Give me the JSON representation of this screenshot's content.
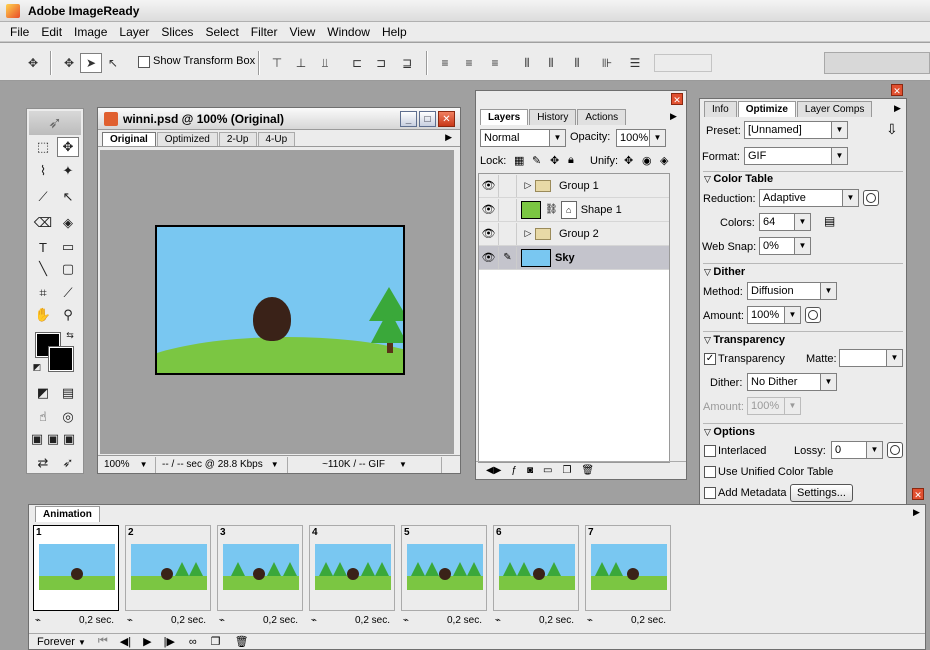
{
  "app": {
    "title": "Adobe ImageReady"
  },
  "menu": [
    "File",
    "Edit",
    "Image",
    "Layer",
    "Slices",
    "Select",
    "Filter",
    "View",
    "Window",
    "Help"
  ],
  "options_bar": {
    "show_transform_box": "Show Transform Box"
  },
  "document": {
    "title": "winni.psd @ 100% (Original)",
    "tabs": [
      "Original",
      "Optimized",
      "2-Up",
      "4-Up"
    ],
    "active_tab": "Original",
    "zoom": "100%",
    "download_time": "-- / -- sec @ 28.8 Kbps",
    "file_size": "~110K / -- GIF"
  },
  "layers_palette": {
    "tabs": [
      "Layers",
      "History",
      "Actions"
    ],
    "active_tab": "Layers",
    "blend_mode": "Normal",
    "opacity_label": "Opacity:",
    "opacity": "100%",
    "lock_label": "Lock:",
    "unify_label": "Unify:",
    "layers": [
      {
        "name": "Group 1",
        "kind": "group"
      },
      {
        "name": "Shape 1",
        "kind": "shape"
      },
      {
        "name": "Group 2",
        "kind": "group"
      },
      {
        "name": "Sky",
        "kind": "layer",
        "selected": true
      }
    ]
  },
  "optimize_palette": {
    "tabs": [
      "Info",
      "Optimize",
      "Layer Comps"
    ],
    "active_tab": "Optimize",
    "preset_label": "Preset:",
    "preset": "[Unnamed]",
    "format_label": "Format:",
    "format": "GIF",
    "color_table": {
      "title": "Color Table",
      "reduction_label": "Reduction:",
      "reduction": "Adaptive",
      "colors_label": "Colors:",
      "colors": "64",
      "web_snap_label": "Web Snap:",
      "web_snap": "0%"
    },
    "dither": {
      "title": "Dither",
      "method_label": "Method:",
      "method": "Diffusion",
      "amount_label": "Amount:",
      "amount": "100%"
    },
    "transparency": {
      "title": "Transparency",
      "transparency_label": "Transparency",
      "transparency_checked": true,
      "matte_label": "Matte:",
      "dither_label": "Dither:",
      "dither": "No Dither",
      "amount_label": "Amount:",
      "amount": "100%"
    },
    "options": {
      "title": "Options",
      "interlaced_label": "Interlaced",
      "lossy_label": "Lossy:",
      "lossy": "0",
      "unified_color_table_label": "Use Unified Color Table",
      "add_metadata_label": "Add Metadata",
      "settings_button": "Settings..."
    }
  },
  "animation_palette": {
    "tab": "Animation",
    "loop": "Forever",
    "frames": [
      {
        "num": "1",
        "delay": "0,2 sec."
      },
      {
        "num": "2",
        "delay": "0,2 sec."
      },
      {
        "num": "3",
        "delay": "0,2 sec."
      },
      {
        "num": "4",
        "delay": "0,2 sec."
      },
      {
        "num": "5",
        "delay": "0,2 sec."
      },
      {
        "num": "6",
        "delay": "0,2 sec."
      },
      {
        "num": "7",
        "delay": "0,2 sec."
      }
    ]
  }
}
